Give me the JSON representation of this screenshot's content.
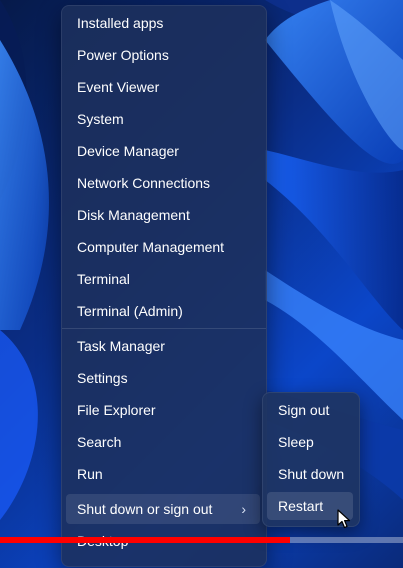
{
  "context_menu": {
    "group1": [
      "Installed apps",
      "Power Options",
      "Event Viewer",
      "System",
      "Device Manager",
      "Network Connections",
      "Disk Management",
      "Computer Management",
      "Terminal",
      "Terminal (Admin)"
    ],
    "group2": [
      "Task Manager",
      "Settings",
      "File Explorer",
      "Search",
      "Run",
      "Shut down or sign out",
      "Desktop"
    ],
    "submenu_arrow": "›"
  },
  "shutdown_submenu": {
    "items": [
      "Sign out",
      "Sleep",
      "Shut down",
      "Restart"
    ],
    "highlighted": "Restart"
  },
  "video_progress": {
    "fraction": 0.72,
    "color": "#ff0000"
  },
  "icons": {
    "cursor": "mouse-pointer-icon",
    "submenu_arrow": "chevron-right-icon"
  }
}
